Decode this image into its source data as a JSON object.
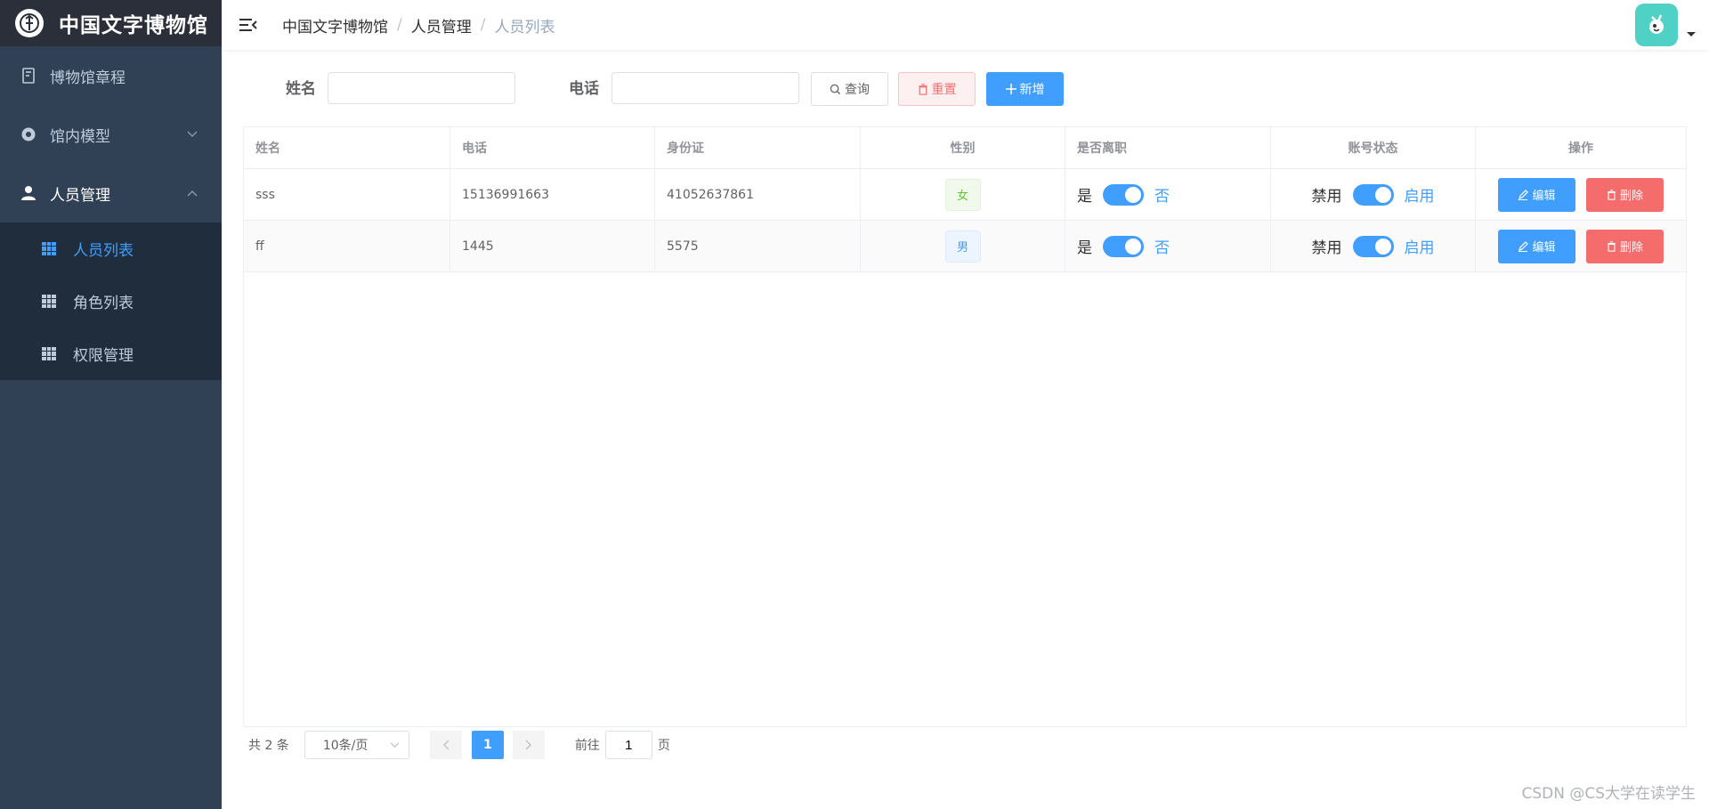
{
  "app": {
    "title": "中国文字博物馆"
  },
  "sidebar": {
    "items": [
      {
        "label": "博物馆章程"
      },
      {
        "label": "馆内模型"
      },
      {
        "label": "人员管理"
      }
    ],
    "submenu": [
      {
        "label": "人员列表"
      },
      {
        "label": "角色列表"
      },
      {
        "label": "权限管理"
      }
    ]
  },
  "breadcrumb": [
    "中国文字博物馆",
    "人员管理",
    "人员列表"
  ],
  "search": {
    "name_label": "姓名",
    "phone_label": "电话",
    "name_value": "",
    "phone_value": "",
    "query_label": "查询",
    "reset_label": "重置",
    "add_label": "新增"
  },
  "table": {
    "headers": [
      "姓名",
      "电话",
      "身份证",
      "性别",
      "是否离职",
      "账号状态",
      "操作"
    ],
    "rows": [
      {
        "name": "sss",
        "phone": "15136991663",
        "id_card": "41052637861",
        "gender": "女",
        "resigned_yes": "是",
        "resigned_no": "否",
        "status_off": "禁用",
        "status_on": "启用",
        "edit": "编辑",
        "delete": "删除"
      },
      {
        "name": "ff",
        "phone": "1445",
        "id_card": "5575",
        "gender": "男",
        "resigned_yes": "是",
        "resigned_no": "否",
        "status_off": "禁用",
        "status_on": "启用",
        "edit": "编辑",
        "delete": "删除"
      }
    ]
  },
  "pagination": {
    "total": "共 2 条",
    "page_size": "10条/页",
    "current_page": "1",
    "goto_label": "前往",
    "goto_value": "1",
    "page_suffix": "页"
  },
  "watermark": "CSDN @CS大学在读学生",
  "colors": {
    "primary": "#409eff",
    "danger": "#f56c6c",
    "sidebar": "#304156",
    "sidebar_sub": "#1f2d3d",
    "success": "#67c23a"
  }
}
